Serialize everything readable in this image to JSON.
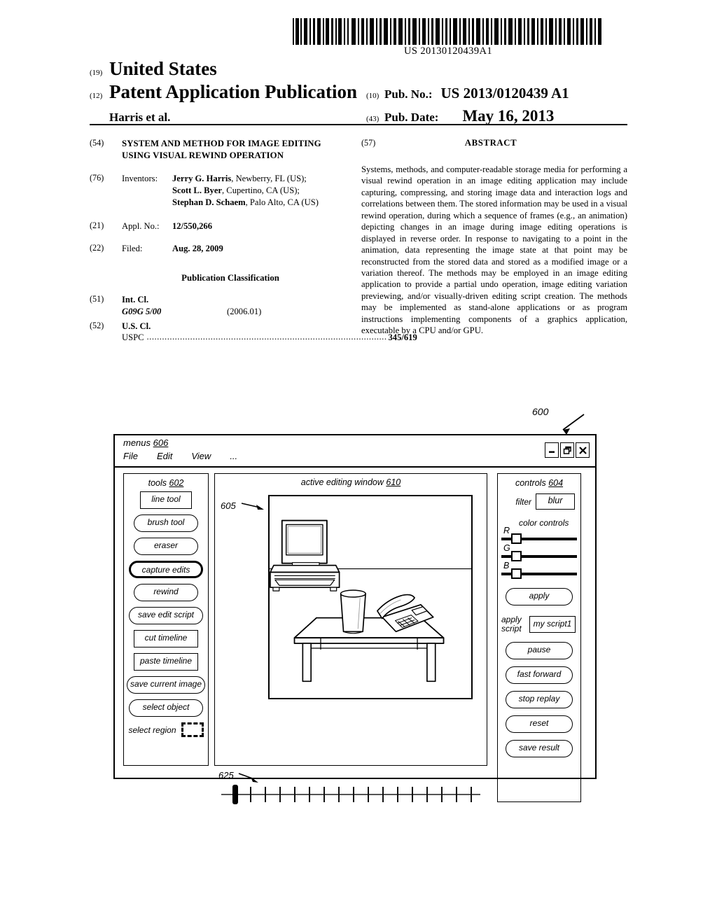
{
  "barcode": {
    "number": "US 20130120439A1"
  },
  "header": {
    "inid_19": "(19)",
    "country": "United States",
    "inid_12": "(12)",
    "doc_type": "Patent Application Publication",
    "applicant": "Harris et al.",
    "inid_10": "(10)",
    "pubno_label": "Pub. No.:",
    "pubno_value": "US 2013/0120439 A1",
    "inid_43": "(43)",
    "pubdate_label": "Pub. Date:",
    "pubdate_value": "May 16, 2013"
  },
  "left_column": {
    "title_inid": "(54)",
    "title": "SYSTEM AND METHOD FOR IMAGE EDITING USING VISUAL REWIND OPERATION",
    "inventors_inid": "(76)",
    "inventors_label": "Inventors:",
    "inventors": [
      {
        "name": "Jerry G. Harris",
        "location": ", Newberry, FL (US);"
      },
      {
        "name": "Scott L. Byer",
        "location": ", Cupertino, CA (US);"
      },
      {
        "name": "Stephan D. Schaem",
        "location": ", Palo Alto, CA (US)"
      }
    ],
    "applno_inid": "(21)",
    "applno_label": "Appl. No.:",
    "applno_value": "12/550,266",
    "filed_inid": "(22)",
    "filed_label": "Filed:",
    "filed_value": "Aug. 28, 2009",
    "pub_class_heading": "Publication Classification",
    "intcl_inid": "(51)",
    "intcl_label": "Int. Cl.",
    "intcl_code": "G09G 5/00",
    "intcl_version": "(2006.01)",
    "uscl_inid": "(52)",
    "uscl_label": "U.S. Cl.",
    "uspc_label": "USPC",
    "uspc_dots": "..............................................................................................",
    "uspc_value": "345/619"
  },
  "abstract": {
    "inid": "(57)",
    "heading": "ABSTRACT",
    "text": "Systems, methods, and computer-readable storage media for performing a visual rewind operation in an image editing application may include capturing, compressing, and storing image data and interaction logs and correlations between them. The stored information may be used in a visual rewind operation, during which a sequence of frames (e.g., an animation) depicting changes in an image during image editing operations is displayed in reverse order. In response to navigating to a point in the animation, data representing the image state at that point may be reconstructed from the stored data and stored as a modified image or a variation thereof. The methods may be employed in an image editing application to provide a partial undo operation, image editing variation previewing, and/or visually-driven editing script creation. The methods may be implemented as stand-alone applications or as program instructions implementing components of a graphics application, executable by a CPU and/or GPU."
  },
  "figure": {
    "ref_600": "600",
    "window": {
      "menus_label": "menus",
      "menus_ref": "606",
      "menu_items": [
        "File",
        "Edit",
        "View",
        "..."
      ],
      "window_buttons": [
        {
          "name": "minimize-button",
          "icon": "minimize-icon"
        },
        {
          "name": "maximize-button",
          "icon": "restore-icon"
        },
        {
          "name": "close-button",
          "icon": "close-icon"
        }
      ]
    },
    "tools_panel": {
      "label": "tools",
      "ref": "602",
      "buttons": [
        {
          "label": "line tool",
          "shape": "rect",
          "width": "w-narrow",
          "selected": false
        },
        {
          "label": "brush tool",
          "shape": "rounded",
          "width": "w-mid",
          "selected": false
        },
        {
          "label": "eraser",
          "shape": "rounded",
          "width": "w-mid",
          "selected": false
        },
        {
          "label": "capture edits",
          "shape": "sel",
          "width": "w-wide",
          "selected": true
        },
        {
          "label": "rewind",
          "shape": "rounded",
          "width": "w-mid",
          "selected": false
        },
        {
          "label": "save edit script",
          "shape": "rounded",
          "width": "w-wide",
          "selected": false
        },
        {
          "label": "cut timeline",
          "shape": "rect",
          "width": "w-mid",
          "selected": false
        },
        {
          "label": "paste timeline",
          "shape": "rect",
          "width": "w-mid",
          "selected": false
        },
        {
          "label": "save current image",
          "shape": "rounded",
          "width": "w-full",
          "selected": false
        },
        {
          "label": "select object",
          "shape": "rounded",
          "width": "w-wide",
          "selected": false
        }
      ],
      "select_region_label": "select region",
      "select_region_icon": "marquee-selection-icon"
    },
    "editing_area": {
      "title_label": "active editing window",
      "title_ref": "610",
      "canvas_ref": "605",
      "canvas_contents": [
        "television on stand",
        "coffee table",
        "drinking glass",
        "telephone"
      ]
    },
    "timeline": {
      "ref": "625",
      "tick_count": 17,
      "playhead_position": 0
    },
    "controls_panel": {
      "label": "controls",
      "ref": "604",
      "filter_label": "filter",
      "filter_value": "blur",
      "color_controls_label": "color controls",
      "sliders": [
        {
          "label": "R",
          "value": 10
        },
        {
          "label": "G",
          "value": 10
        },
        {
          "label": "B",
          "value": 10
        }
      ],
      "apply_label": "apply",
      "apply_script_label": "apply script",
      "script_value": "my script1",
      "buttons": [
        "pause",
        "fast forward",
        "stop replay",
        "reset",
        "save result"
      ]
    }
  }
}
